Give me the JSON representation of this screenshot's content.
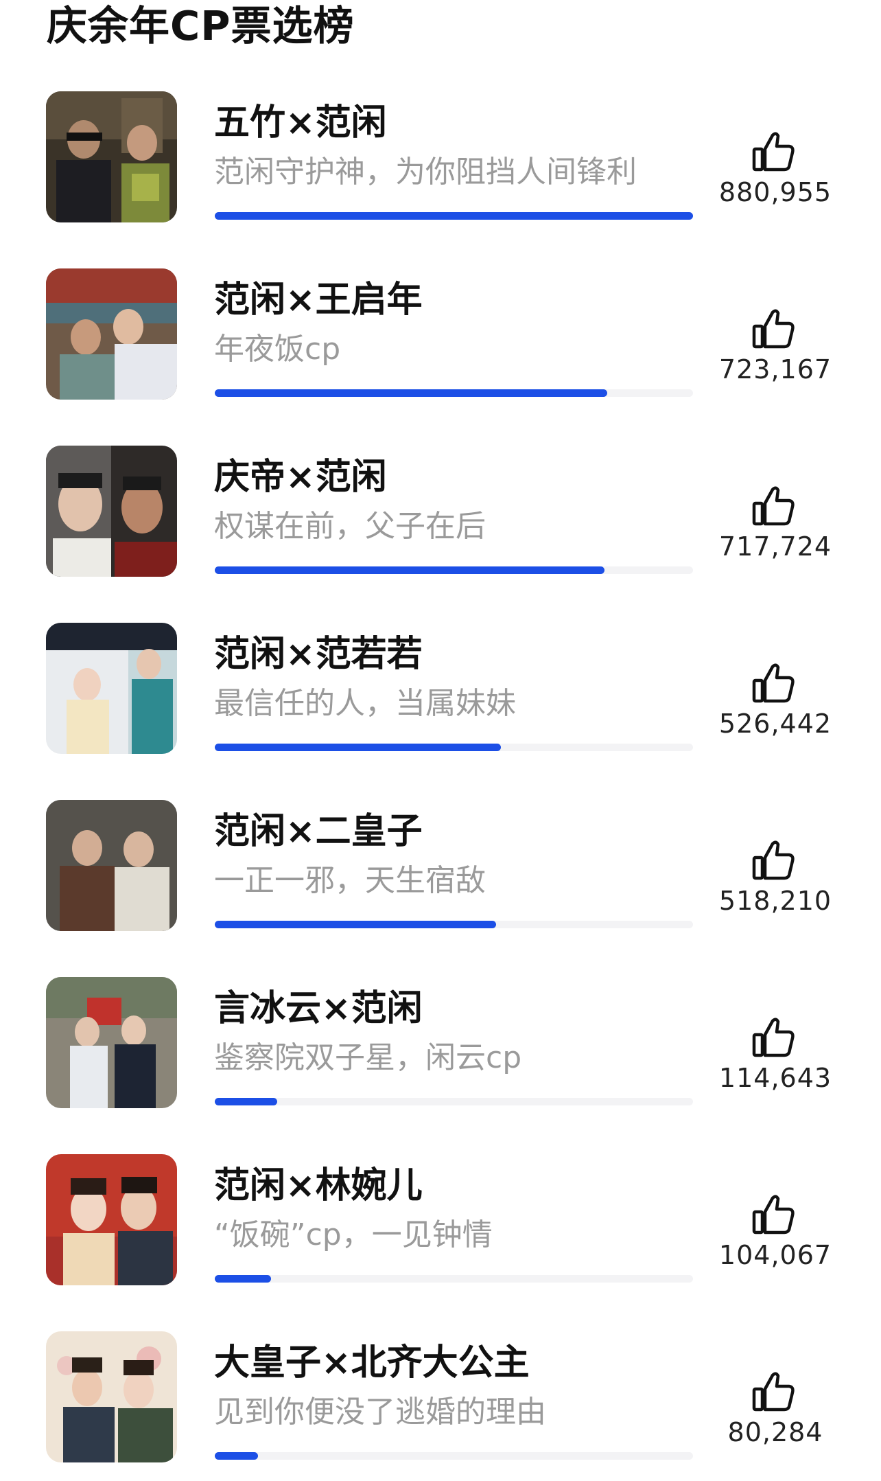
{
  "page_title": "庆余年CP票选榜",
  "colors": {
    "accent": "#1c4fe6",
    "track": "#f3f3f5",
    "slogan": "#9a9a9a"
  },
  "icons": {
    "vote": "thumbs-up-outline-icon"
  },
  "entries": [
    {
      "name": "五竹×范闲",
      "slogan": "范闲守护神，为你阻挡人间锋利",
      "votes": "880,955",
      "share": 1.0
    },
    {
      "name": "范闲×王启年",
      "slogan": "年夜饭cp",
      "votes": "723,167",
      "share": 0.821
    },
    {
      "name": "庆帝×范闲",
      "slogan": "权谋在前，父子在后",
      "votes": "717,724",
      "share": 0.815
    },
    {
      "name": "范闲×范若若",
      "slogan": "最信任的人，当属妹妹",
      "votes": "526,442",
      "share": 0.598
    },
    {
      "name": "范闲×二皇子",
      "slogan": "一正一邪，天生宿敌",
      "votes": "518,210",
      "share": 0.588
    },
    {
      "name": "言冰云×范闲",
      "slogan": "鉴察院双子星，闲云cp",
      "votes": "114,643",
      "share": 0.13
    },
    {
      "name": "范闲×林婉儿",
      "slogan": "“饭碗”cp，一见钟情",
      "votes": "104,067",
      "share": 0.118
    },
    {
      "name": "大皇子×北齐大公主",
      "slogan": "见到你便没了逃婚的理由",
      "votes": "80,284",
      "share": 0.091
    }
  ]
}
